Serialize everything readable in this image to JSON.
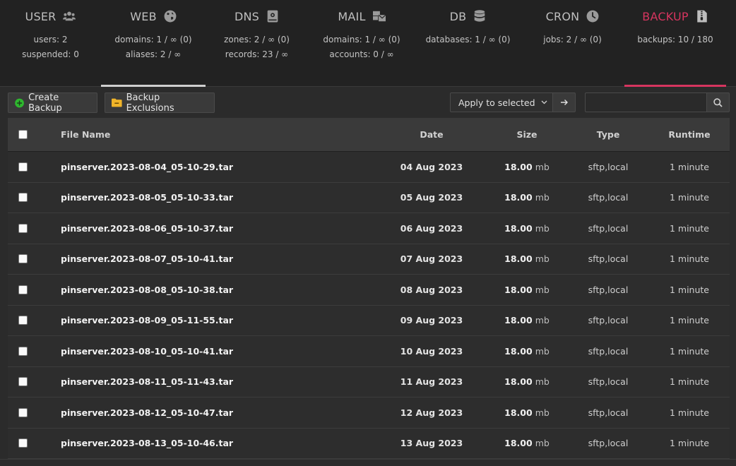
{
  "tabs": [
    {
      "key": "user",
      "label": "USER",
      "icon": "users-icon",
      "stats": [
        "users: 2",
        "suspended: 0"
      ],
      "width": 143
    },
    {
      "key": "web",
      "label": "WEB",
      "icon": "globe-icon",
      "stats": [
        "domains: 1 / ∞ (0)",
        "aliases: 2 / ∞"
      ],
      "width": 148
    },
    {
      "key": "dns",
      "label": "DNS",
      "icon": "book-icon",
      "stats": [
        "zones: 2 / ∞ (0)",
        "records: 23 / ∞"
      ],
      "width": 145
    },
    {
      "key": "mail",
      "label": "MAIL",
      "icon": "mail-bulk-icon",
      "stats": [
        "domains: 1 / ∞ (0)",
        "accounts: 0 / ∞"
      ],
      "width": 152
    },
    {
      "key": "db",
      "label": "DB",
      "icon": "database-icon",
      "stats": [
        "databases: 1 / ∞ (0)"
      ],
      "width": 149
    },
    {
      "key": "cron",
      "label": "CRON",
      "icon": "clock-icon",
      "stats": [
        "jobs: 2 / ∞ (0)"
      ],
      "width": 147
    },
    {
      "key": "backup",
      "label": "BACKUP",
      "icon": "file-archive-icon",
      "stats": [
        "backups: 10 / 180"
      ],
      "width": 144
    }
  ],
  "toolbar": {
    "create_backup_label": "Create Backup",
    "backup_exclusions_label": "Backup Exclusions",
    "apply_select_value": "Apply to selected",
    "search_placeholder": ""
  },
  "table": {
    "headers": {
      "name": "File Name",
      "date": "Date",
      "size": "Size",
      "type": "Type",
      "runtime": "Runtime"
    },
    "rows": [
      {
        "name": "pinserver.2023-08-04_05-10-29.tar",
        "date": "04 Aug 2023",
        "size": "18.00",
        "unit": "mb",
        "type": "sftp,local",
        "runtime": "1 minute"
      },
      {
        "name": "pinserver.2023-08-05_05-10-33.tar",
        "date": "05 Aug 2023",
        "size": "18.00",
        "unit": "mb",
        "type": "sftp,local",
        "runtime": "1 minute"
      },
      {
        "name": "pinserver.2023-08-06_05-10-37.tar",
        "date": "06 Aug 2023",
        "size": "18.00",
        "unit": "mb",
        "type": "sftp,local",
        "runtime": "1 minute"
      },
      {
        "name": "pinserver.2023-08-07_05-10-41.tar",
        "date": "07 Aug 2023",
        "size": "18.00",
        "unit": "mb",
        "type": "sftp,local",
        "runtime": "1 minute"
      },
      {
        "name": "pinserver.2023-08-08_05-10-38.tar",
        "date": "08 Aug 2023",
        "size": "18.00",
        "unit": "mb",
        "type": "sftp,local",
        "runtime": "1 minute"
      },
      {
        "name": "pinserver.2023-08-09_05-11-55.tar",
        "date": "09 Aug 2023",
        "size": "18.00",
        "unit": "mb",
        "type": "sftp,local",
        "runtime": "1 minute"
      },
      {
        "name": "pinserver.2023-08-10_05-10-41.tar",
        "date": "10 Aug 2023",
        "size": "18.00",
        "unit": "mb",
        "type": "sftp,local",
        "runtime": "1 minute"
      },
      {
        "name": "pinserver.2023-08-11_05-11-43.tar",
        "date": "11 Aug 2023",
        "size": "18.00",
        "unit": "mb",
        "type": "sftp,local",
        "runtime": "1 minute"
      },
      {
        "name": "pinserver.2023-08-12_05-10-47.tar",
        "date": "12 Aug 2023",
        "size": "18.00",
        "unit": "mb",
        "type": "sftp,local",
        "runtime": "1 minute"
      },
      {
        "name": "pinserver.2023-08-13_05-10-46.tar",
        "date": "13 Aug 2023",
        "size": "18.00",
        "unit": "mb",
        "type": "sftp,local",
        "runtime": "1 minute"
      }
    ]
  },
  "colors": {
    "accent": "#d6355f",
    "create_icon": "#2eb82e",
    "folder_icon": "#f0b429"
  }
}
